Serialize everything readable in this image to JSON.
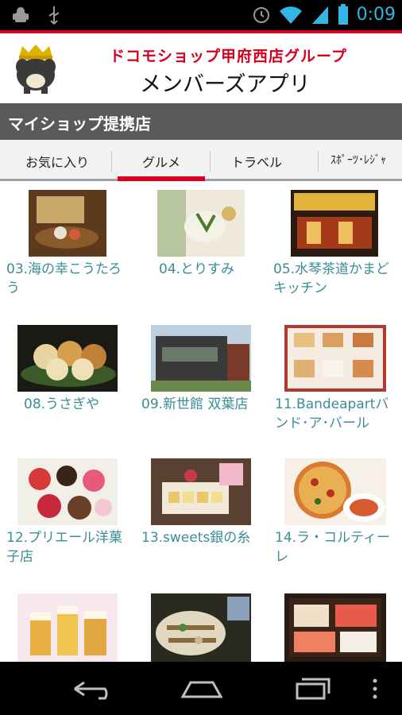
{
  "status": {
    "time": "0:09"
  },
  "header": {
    "subtitle": "ドコモショップ甲府西店グループ",
    "title": "メンバーズアプリ"
  },
  "section": {
    "title": "マイショップ提携店"
  },
  "tabs": [
    {
      "label": "お気に入り"
    },
    {
      "label": "グルメ"
    },
    {
      "label": "トラベル"
    },
    {
      "label": "ｽﾎﾟｰﾂ･ﾚｼﾞｬ"
    }
  ],
  "shops": [
    {
      "caption": "03.海の幸こうたろう"
    },
    {
      "caption": "04.とりすみ"
    },
    {
      "caption": "05.水琴茶道かまどキッチン"
    },
    {
      "caption": "08.うさぎや"
    },
    {
      "caption": "09.新世館 双葉店"
    },
    {
      "caption": "11.Bandeapartバンド･ア･バール"
    },
    {
      "caption": "12.プリエール洋菓子店"
    },
    {
      "caption": "13.sweets銀の糸"
    },
    {
      "caption": "14.ラ・コルティーレ"
    },
    {
      "caption": ""
    },
    {
      "caption": ""
    },
    {
      "caption": ""
    }
  ],
  "colors": {
    "accent": "#d6001c",
    "caption": "#3a8c98",
    "sectionbar": "#5a5a5a"
  }
}
